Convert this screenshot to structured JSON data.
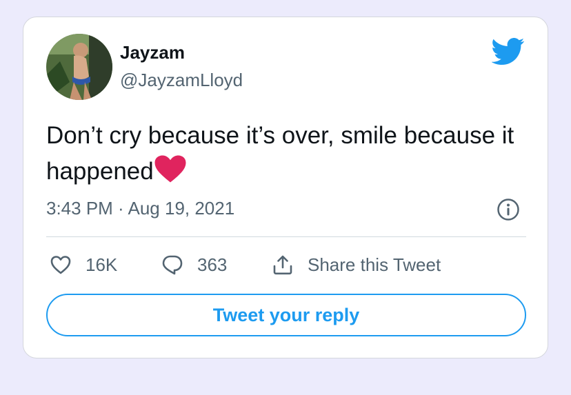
{
  "colors": {
    "background": "#ecebfc",
    "card": "#ffffff",
    "text": "#0f1419",
    "muted": "#536471",
    "accent": "#1d9bf0",
    "heart": "#e0245e"
  },
  "author": {
    "name": "Jayzam",
    "handle": "@JayzamLloyd",
    "avatar_icon": "avatar-photo"
  },
  "tweet": {
    "text": "Don’t cry because it’s over, smile because it happened",
    "emoji": "red-heart-emoji",
    "timestamp": "3:43 PM · Aug 19, 2021"
  },
  "actions": {
    "like_count": "16K",
    "reply_count": "363",
    "share_label": "Share this Tweet"
  },
  "reply_button": {
    "label": "Tweet your reply"
  },
  "icons": {
    "brand": "twitter-bird-icon",
    "info": "info-icon",
    "like": "heart-outline-icon",
    "reply": "speech-bubble-icon",
    "share": "share-upload-icon"
  }
}
